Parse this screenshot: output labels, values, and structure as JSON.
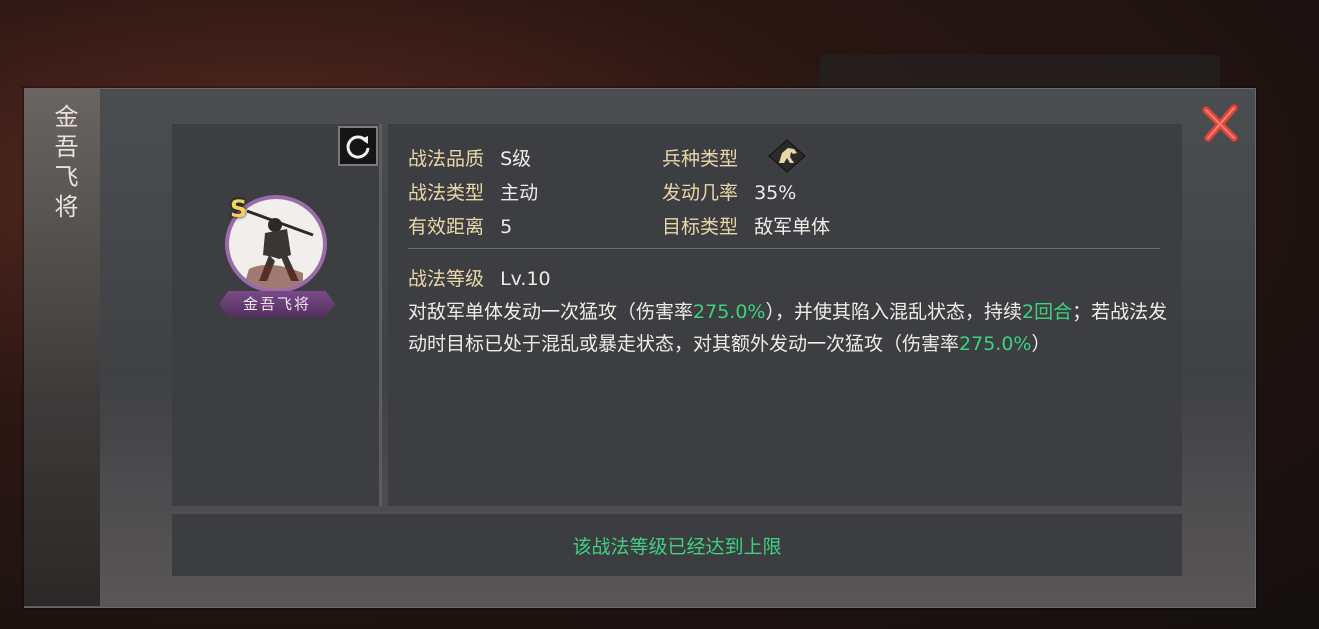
{
  "background": {
    "tabs": [
      "",
      "",
      ""
    ]
  },
  "dialog": {
    "title": "金吾飞将",
    "close_label": "×"
  },
  "hero": {
    "grade": "S",
    "name": "金吾飞将"
  },
  "skill_info": {
    "quality_label": "战法品质",
    "quality_value": "S级",
    "type_label": "战法类型",
    "type_value": "主动",
    "range_label": "有效距离",
    "range_value": "5",
    "troop_label": "兵种类型",
    "troop_icon": "horse-icon",
    "chance_label": "发动几率",
    "chance_value": "35%",
    "target_label": "目标类型",
    "target_value": "敌军单体",
    "level_label": "战法等级",
    "level_value": "Lv.10"
  },
  "description": {
    "p1": "对敌军单体发动一次猛攻（伤害率",
    "v1": "275.0%",
    "p2": "），并使其陷入混乱状态，持续",
    "v2": "2回合",
    "p3": "；若战法发动时目标已处于混乱或暴走状态，对其额外发动一次猛攻（伤害率",
    "v3": "275.0%",
    "p4": "）"
  },
  "footer": {
    "message": "该战法等级已经达到上限"
  },
  "colors": {
    "label": "#e8d7a8",
    "value": "#efece6",
    "highlight": "#3fd27e",
    "close": "#e0453a",
    "name_plate": "#6a3f78"
  }
}
